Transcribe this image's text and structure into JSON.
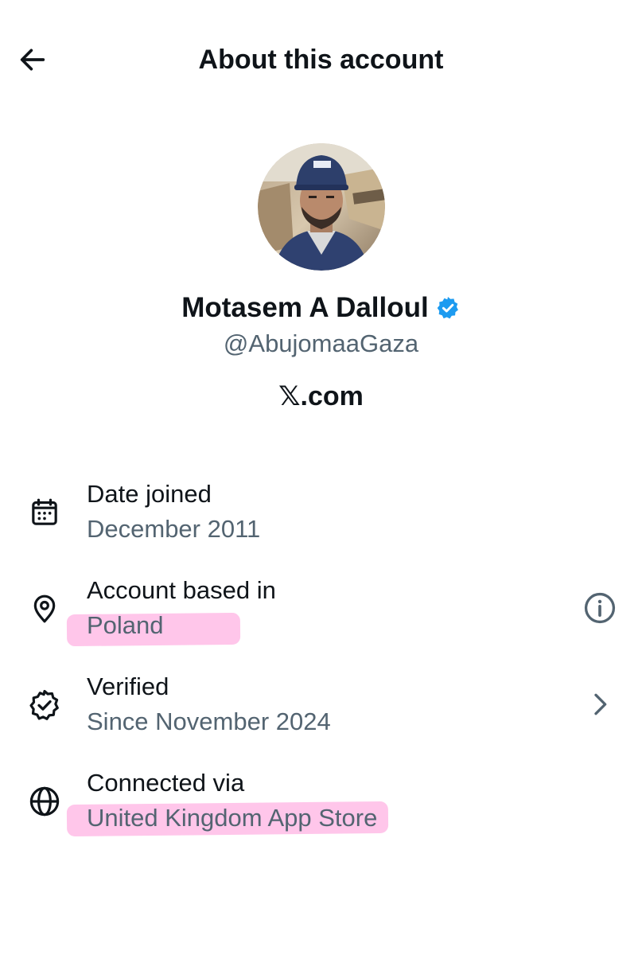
{
  "header": {
    "title": "About this account",
    "back_icon": "arrow-left-icon"
  },
  "profile": {
    "display_name": "Motasem A Dalloul",
    "handle": "@AbujomaaGaza",
    "verified_badge_color": "#1d9bf0",
    "site": "𝕏.com"
  },
  "details": [
    {
      "icon": "calendar-icon",
      "label": "Date joined",
      "value": "December 2011"
    },
    {
      "icon": "location-pin-icon",
      "label": "Account based in",
      "value": "Poland",
      "action_icon": "info-icon",
      "highlighted": true
    },
    {
      "icon": "verified-badge-icon",
      "label": "Verified",
      "value": "Since November 2024",
      "action_icon": "chevron-right-icon"
    },
    {
      "icon": "globe-icon",
      "label": "Connected via",
      "value": "United Kingdom App Store",
      "highlighted": true
    }
  ],
  "colors": {
    "text_primary": "#0f1419",
    "text_secondary": "#536471",
    "highlight": "#ff69c8"
  }
}
